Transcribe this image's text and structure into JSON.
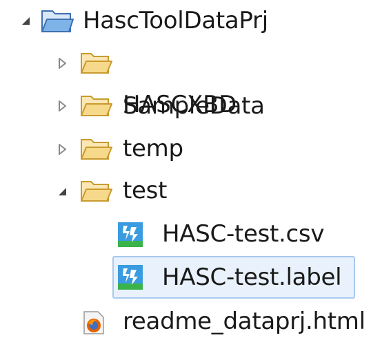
{
  "project_tree": {
    "root": {
      "label": "HascToolDataPrj",
      "expanded": true,
      "icon": "project-folder-icon"
    },
    "children": [
      {
        "label": "HASCXBD",
        "type": "folder",
        "expanded": false,
        "icon": "folder-icon"
      },
      {
        "label": "SampleData",
        "type": "folder",
        "expanded": false,
        "icon": "folder-icon"
      },
      {
        "label": "temp",
        "type": "folder",
        "expanded": false,
        "icon": "folder-icon"
      },
      {
        "label": "test",
        "type": "folder",
        "expanded": true,
        "icon": "folder-icon",
        "children": [
          {
            "label": "HASC-test.csv",
            "type": "file",
            "icon": "hasc-file-icon",
            "selected": false
          },
          {
            "label": "HASC-test.label",
            "type": "file",
            "icon": "hasc-file-icon",
            "selected": true
          }
        ]
      },
      {
        "label": "readme_dataprj.html",
        "type": "file",
        "icon": "firefox-html-icon"
      }
    ]
  },
  "colors": {
    "selection_fill": "#e8f1fc",
    "selection_border": "#a9c9ee",
    "folder_fill": "#f7d98b",
    "project_folder_fill": "#7eb3e8"
  }
}
